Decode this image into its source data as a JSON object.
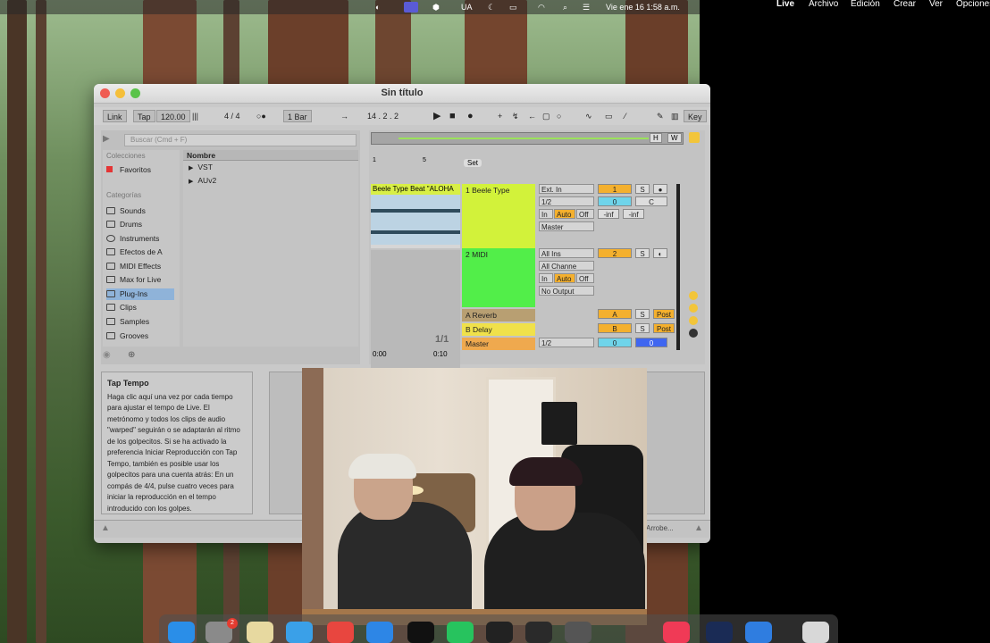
{
  "menubar_main": {
    "items": [
      "UA"
    ],
    "clock": "Vie ene 16 1:58 a.m."
  },
  "menubar_secondary": {
    "app": "Live",
    "items": [
      "Archivo",
      "Edición",
      "Crear",
      "Ver",
      "Opciones"
    ]
  },
  "window": {
    "title": "Sin título"
  },
  "control_bar": {
    "link": "Link",
    "tap": "Tap",
    "tempo": "120.00",
    "signature": "4 / 4",
    "quantize": "1 Bar",
    "position": "14 .   2 .   2",
    "hw_h": "H",
    "hw_w": "W",
    "key": "Key"
  },
  "browser": {
    "search_placeholder": "Buscar (Cmd + F)",
    "collections_header": "Colecciones",
    "favorites": "Favoritos",
    "categories_header": "Categorías",
    "categories": [
      "Sounds",
      "Drums",
      "Instruments",
      "Efectos de A",
      "MIDI Effects",
      "Max for Live",
      "Plug-Ins",
      "Clips",
      "Samples",
      "Grooves"
    ],
    "selected_category": "Plug-Ins",
    "column_header": "Nombre",
    "items": [
      "VST",
      "AUv2"
    ]
  },
  "session": {
    "ruler": [
      "1",
      "5"
    ],
    "set_label": "Set",
    "clip_name": "Beele Type Beat \"ALOHA",
    "scene_counter": "1/1",
    "time_start": "0:00",
    "time_end": "0:10",
    "tracks": [
      {
        "name": "1 Beele Type",
        "color": "#d2f23a",
        "input": "Ext. In",
        "channel": "1/2",
        "monitor": [
          "In",
          "Auto",
          "Off"
        ],
        "output": "Master",
        "num": "1",
        "s": "S",
        "vol": "0",
        "pan": "C",
        "peak_l": "-inf",
        "peak_r": "-inf"
      },
      {
        "name": "2 MIDI",
        "color": "#52ee49",
        "input": "All Ins",
        "channel": "All Channe",
        "monitor": [
          "In",
          "Auto",
          "Off"
        ],
        "output": "No Output",
        "num": "2",
        "s": "S"
      }
    ],
    "returns": [
      {
        "name": "A Reverb",
        "letter": "A",
        "s": "S",
        "post": "Post"
      },
      {
        "name": "B Delay",
        "letter": "B",
        "s": "S",
        "post": "Post"
      }
    ],
    "master": {
      "name": "Master",
      "channel": "1/2",
      "vol": "0",
      "cue": "0"
    }
  },
  "info_view": {
    "title": "Tap Tempo",
    "body": "Haga clic aquí una vez por cada tiempo para ajustar el tempo de Live. El metrónomo y todos los clips de audio \"warped\" seguirán o se adaptarán al ritmo de los golpecitos. Si se ha activado la preferencia Iniciar Reproducción con Tap Tempo, también es posible usar los golpecitos para una cuenta atrás: En un compás de 4/4, pulse cuatro veces para iniciar la reproducción en el tempo introducido con los golpes."
  },
  "status_bar": {
    "right_text": "Arrobe..."
  },
  "colors": {
    "track1": "#d2f23a",
    "track2": "#52ee49",
    "orange": "#f4b02e",
    "cyan": "#6fd4ea",
    "blue": "#3f66f0"
  }
}
